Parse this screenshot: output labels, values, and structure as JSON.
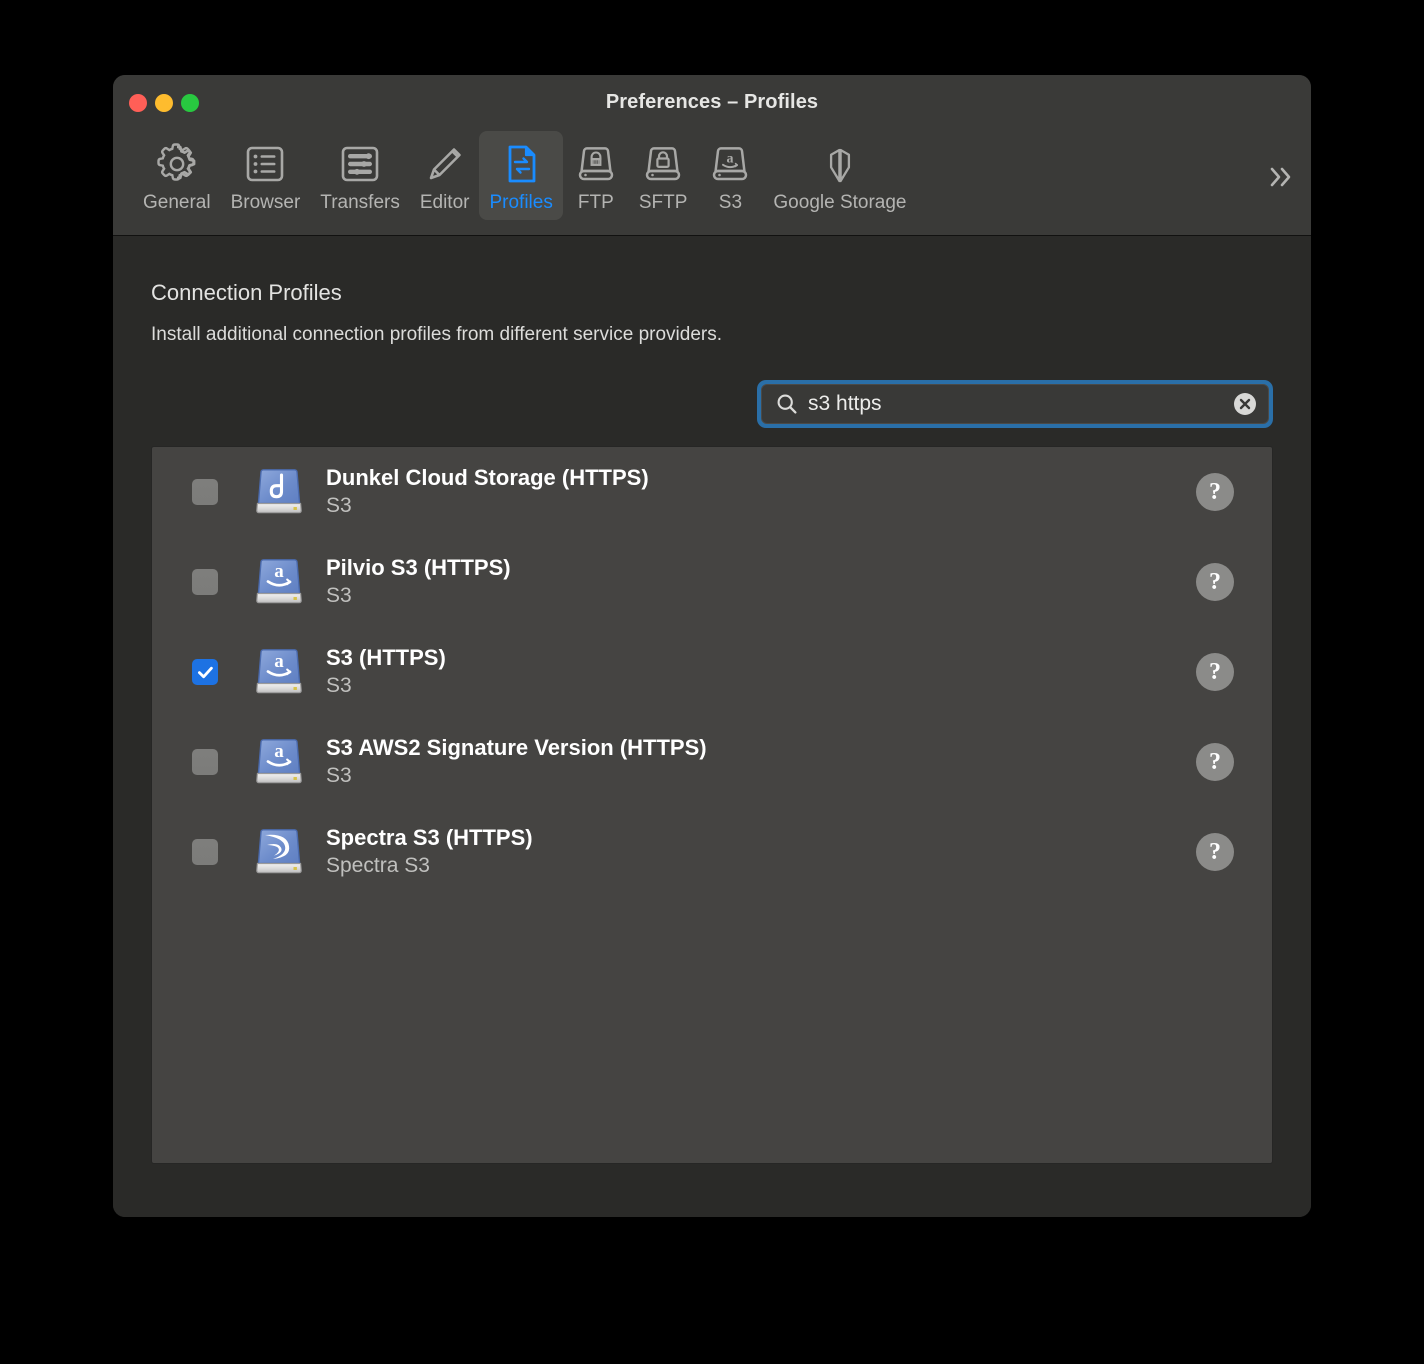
{
  "window": {
    "title": "Preferences – Profiles",
    "traffic_lights": [
      {
        "name": "close",
        "color": "#ff5f57"
      },
      {
        "name": "minimize",
        "color": "#febc2e"
      },
      {
        "name": "zoom",
        "color": "#28c840"
      }
    ]
  },
  "toolbar": {
    "items": [
      {
        "label": "General",
        "icon": "gear-icon",
        "selected": false
      },
      {
        "label": "Browser",
        "icon": "list-box-icon",
        "selected": false
      },
      {
        "label": "Transfers",
        "icon": "sliders-box-icon",
        "selected": false
      },
      {
        "label": "Editor",
        "icon": "pencil-icon",
        "selected": false
      },
      {
        "label": "Profiles",
        "icon": "profiles-document-icon",
        "selected": true
      },
      {
        "label": "FTP",
        "icon": "ftp-drive-icon",
        "selected": false
      },
      {
        "label": "SFTP",
        "icon": "sftp-lock-drive-icon",
        "selected": false
      },
      {
        "label": "S3",
        "icon": "s3-amazon-drive-icon",
        "selected": false
      },
      {
        "label": "Google Storage",
        "icon": "google-storage-icon",
        "selected": false
      }
    ],
    "overflow_icon": "chevron-double-right-icon",
    "accent_color": "#1a8cff",
    "selected_bg": "#4a4a47"
  },
  "main": {
    "heading": "Connection Profiles",
    "subheading": "Install additional connection profiles from different service providers.",
    "search": {
      "icon": "search-icon",
      "value": "s3 https",
      "placeholder": "Search",
      "clear_icon": "clear-circle-icon",
      "focus_ring_color": "#2a6fa8"
    },
    "help_icon": "question-mark-icon",
    "profiles": [
      {
        "name": "Dunkel Cloud Storage (HTTPS)",
        "protocol": "S3",
        "checked": false,
        "icon": "dunkel-drive-icon",
        "help_label": "?"
      },
      {
        "name": "Pilvio S3 (HTTPS)",
        "protocol": "S3",
        "checked": false,
        "icon": "amazon-drive-icon",
        "help_label": "?"
      },
      {
        "name": "S3 (HTTPS)",
        "protocol": "S3",
        "checked": true,
        "icon": "amazon-drive-icon",
        "help_label": "?"
      },
      {
        "name": "S3 AWS2 Signature Version (HTTPS)",
        "protocol": "S3",
        "checked": false,
        "icon": "amazon-drive-icon",
        "help_label": "?"
      },
      {
        "name": "Spectra S3 (HTTPS)",
        "protocol": "Spectra S3",
        "checked": false,
        "icon": "spectra-drive-icon",
        "help_label": "?"
      }
    ]
  }
}
